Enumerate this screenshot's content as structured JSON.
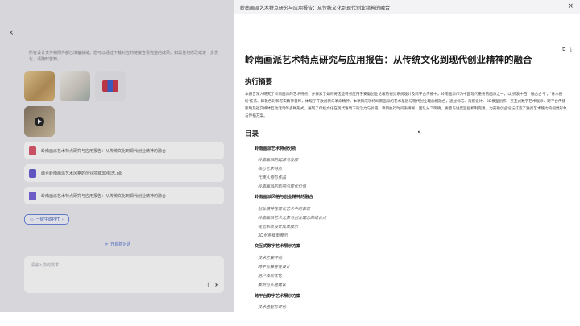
{
  "left": {
    "intro": "所有设计文件和附件都已准备就绪。您可以通过下载对应的链接查看完整的成果。如需任何修改或进一步优化，请随时告知。",
    "files": [
      {
        "name": "岭南画派艺术特点研究与应用报告：从传统文化到现代创业精神的融合",
        "color": "#d8495c"
      },
      {
        "name": "融合岭南画派艺术风格的创业项目3D标志.glb",
        "color": "#5b4fcf"
      },
      {
        "name": "岭南画派艺术特点研究与应用报告：从传统文化到现代创业精神的融合",
        "color": "#6a58d6"
      }
    ],
    "ppt_chip": "一键生成PPT",
    "new_chat": "开启新对话",
    "input_placeholder": "请输入你的需求"
  },
  "right": {
    "tab_title": "岭南画派艺术特点研究与应用报告：从传统文化到现代创业精神的融合",
    "doc_title": "岭南画派艺术特点研究与应用报告：从传统文化到现代创业精神的融合",
    "exec_heading": "执行摘要",
    "exec_text": "本报告深入研究了岭南画派的艺术特点，并探索了如何将这些特点应用于安徽创业论坛的视觉系统设计及跨平台传播中。岭南画派作为中国现代重要的画派之一，以'折衷中西，融合古今'，'骨水撞粉'技法、鲜艳色彩和写实精神著称，体现了开放创新与革命精神，本项目成功将岭南画派的艺术基因与现代创业理念相融合，通过标志、海报设计、3D模型创作、交互式数字艺术展示、跨平台传播策略及社交媒体互动活动等多种形式，展现了传统文化在现代语境下的活力与价值。项目执行时间表清晰，团队分工明确，质量与进度监控机制完善，为安徽创业论坛打造了独具艺术魅力的视觉形象与传播方案。",
    "toc_heading": "目录",
    "toc": [
      {
        "heading": "岭南画派艺术特点分析",
        "items": [
          "岭南画派的起源与发展",
          "核心艺术特点",
          "代表人物与作品",
          "岭南画派的影响与现代价值"
        ]
      },
      {
        "heading": "岭南画派风格与创业精神的融合",
        "items": [
          "创业精神在现代艺术中的表现",
          "岭南画派艺术元素与创业理念的结合点",
          "视觉系统设计成果展示",
          "3D创意模型展示"
        ]
      },
      {
        "heading": "交互式数字艺术展示方案",
        "items": [
          "技术方案评估",
          "跨平台兼容性设计",
          "用户体验优化",
          "案例与实施建议"
        ]
      },
      {
        "heading": "跨平台数字艺术展示方案",
        "items": [
          "技术选型与评估"
        ]
      }
    ]
  }
}
